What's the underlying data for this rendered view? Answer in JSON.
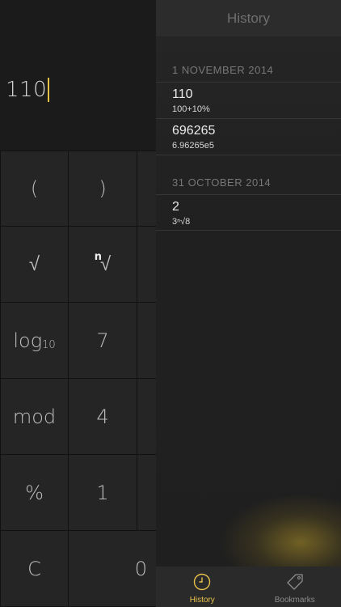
{
  "display": {
    "value": "110"
  },
  "keys": {
    "open_paren": "(",
    "close_paren": ")",
    "sqrt": "√",
    "nth_root_n": "n",
    "nth_root_symbol": "√",
    "log_main": "log",
    "log_sub": "10",
    "seven": "7",
    "mod": "mod",
    "four": "4",
    "percent": "%",
    "one": "1",
    "clear": "C",
    "zero": "0"
  },
  "history": {
    "title": "History",
    "sections": [
      {
        "date": "1 NOVEMBER 2014",
        "entries": [
          {
            "result": "110",
            "expression": "100+10%"
          },
          {
            "result": "696265",
            "expression": "6.96265e5"
          }
        ]
      },
      {
        "date": "31 OCTOBER 2014",
        "entries": [
          {
            "result": "2",
            "expression": "3ⁿ√8"
          }
        ]
      }
    ]
  },
  "tabs": {
    "history_label": "History",
    "bookmarks_label": "Bookmarks"
  },
  "colors": {
    "accent": "#e8c14a",
    "key_bg": "#252525",
    "panel_bg": "#1c1c1c"
  },
  "icons": {
    "history_tab": "clock-icon",
    "bookmarks_tab": "tag-icon"
  }
}
